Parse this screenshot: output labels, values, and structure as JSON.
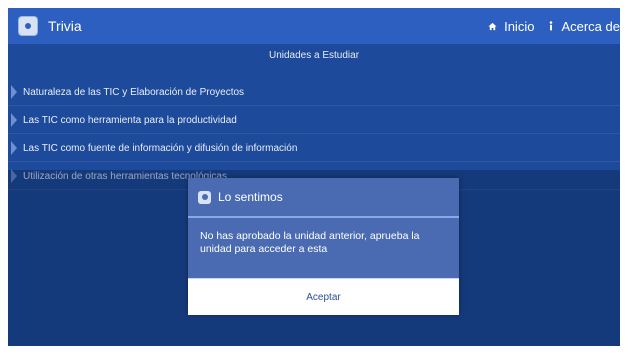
{
  "app": {
    "title": "Trivia",
    "icon": "trivia-app-icon"
  },
  "nav": {
    "items": [
      {
        "label": "Inicio",
        "icon": "home-icon"
      },
      {
        "label": "Acerca de",
        "icon": "info-icon"
      }
    ]
  },
  "main": {
    "section_title": "Unidades a Estudiar",
    "units": [
      {
        "label": "Naturaleza de las TIC y Elaboración de Proyectos"
      },
      {
        "label": "Las TIC como herramienta para la productividad"
      },
      {
        "label": "Las TIC como fuente de información y difusión de información"
      },
      {
        "label": "Utilización de otras herramientas tecnológicas"
      }
    ]
  },
  "dialog": {
    "title": "Lo sentimos",
    "message": "No has aprobado la unidad anterior, aprueba la unidad para acceder a esta",
    "accept_label": "Aceptar"
  },
  "colors": {
    "topbar": "#2c5fc0",
    "background": "#1d4a9a",
    "dialog": "#4a6bb2",
    "accent_line": "#8aa8e6"
  }
}
